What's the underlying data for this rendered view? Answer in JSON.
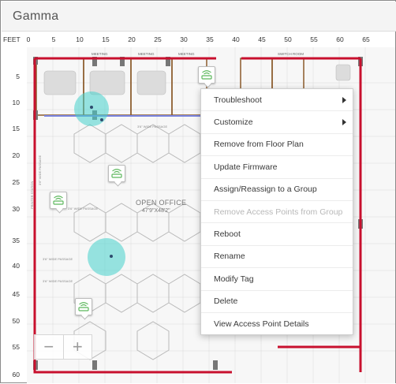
{
  "header": {
    "title": "Gamma"
  },
  "ruler": {
    "unit": "FEET",
    "x_ticks": [
      "0",
      "5",
      "10",
      "15",
      "20",
      "25",
      "30",
      "35",
      "40",
      "45",
      "50",
      "55",
      "60",
      "65"
    ],
    "y_ticks": [
      "5",
      "10",
      "15",
      "20",
      "25",
      "30",
      "35",
      "40",
      "45",
      "50",
      "55",
      "60"
    ]
  },
  "floor_plan": {
    "labels": {
      "meeting_1": "MEETING",
      "meeting_2": "MEETING",
      "meeting_3": "MEETING",
      "switch_room": "SWITCH ROOM",
      "open_office": "OPEN OFFICE",
      "open_office_dim": "47'9\"X48'2\"",
      "passage_1": "3'6\" WIDE PASSAGE",
      "passage_2": "3'6\" WIDE PASSAGE",
      "passage_3": "3'6\" WIDE PASSAGE",
      "passage_4": "3'6\" WIDE PASSAGE",
      "printer_station": "PRINTER STATION",
      "passage_vertical": "3'6\" WIDE PASSAGE"
    }
  },
  "zoom": {
    "minus": "−",
    "plus": "+"
  },
  "context_menu": {
    "items": [
      {
        "label": "Troubleshoot",
        "submenu": true,
        "enabled": true
      },
      {
        "label": "Customize",
        "submenu": true,
        "enabled": true
      },
      {
        "label": "Remove from Floor Plan",
        "submenu": false,
        "enabled": true
      },
      {
        "label": "Update Firmware",
        "submenu": false,
        "enabled": true
      },
      {
        "label": "Assign/Reassign to a Group",
        "submenu": false,
        "enabled": true
      },
      {
        "label": "Remove Access Points from Group",
        "submenu": false,
        "enabled": false
      },
      {
        "label": "Reboot",
        "submenu": false,
        "enabled": true
      },
      {
        "label": "Rename",
        "submenu": false,
        "enabled": true
      },
      {
        "label": "Modify Tag",
        "submenu": false,
        "enabled": true
      },
      {
        "label": "Delete",
        "submenu": false,
        "enabled": true
      },
      {
        "label": "View Access Point Details",
        "submenu": false,
        "enabled": true
      }
    ]
  },
  "icons": {
    "access_point": "wifi-router-icon",
    "submenu_arrow": "chevron-right-icon"
  },
  "colors": {
    "wall": "#c8102e",
    "interior_wall": "#8b5a2b",
    "ap_icon": "#5cb85c",
    "coverage": "#46d2cc",
    "selection_line": "#7b86e0"
  }
}
